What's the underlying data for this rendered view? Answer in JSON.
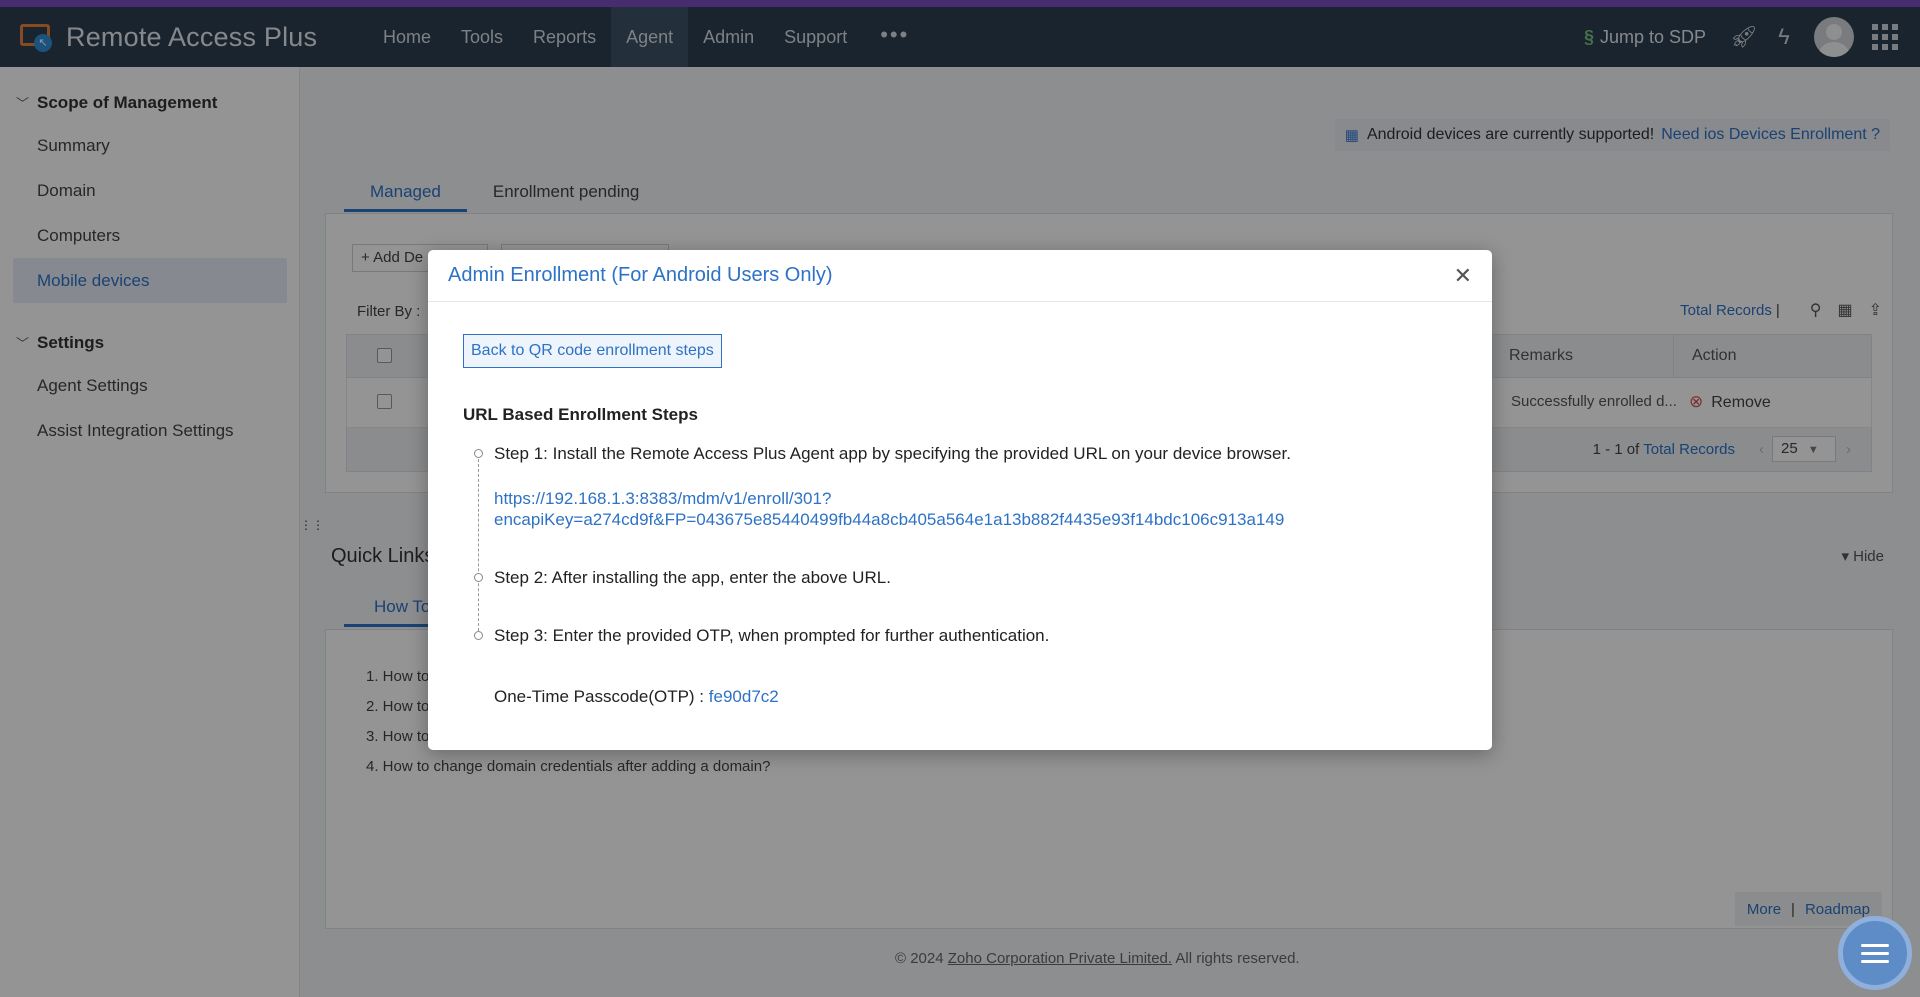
{
  "header": {
    "brand": "Remote Access Plus",
    "nav": [
      "Home",
      "Tools",
      "Reports",
      "Agent",
      "Admin",
      "Support"
    ],
    "nav_more": "•••",
    "jump_label": "Jump to SDP"
  },
  "sidebar": {
    "scope_title": "Scope of Management",
    "scope_items": [
      "Summary",
      "Domain",
      "Computers",
      "Mobile devices"
    ],
    "settings_title": "Settings",
    "settings_items": [
      "Agent Settings",
      "Assist Integration Settings"
    ]
  },
  "main": {
    "notice_text": "Android devices are currently supported!",
    "notice_link": "Need ios Devices Enrollment ?",
    "tabs": [
      "Managed",
      "Enrollment pending"
    ],
    "add_button": "Add De",
    "filter_label": "Filter By :",
    "total_records_link": "Total Records",
    "total_records_sep": "|",
    "table": {
      "col_remarks": "Remarks",
      "col_action": "Action",
      "row_remark": "Successfully enrolled d...",
      "row_action": "Remove"
    },
    "pager": {
      "range": "1 - 1 of",
      "total_link": "Total Records",
      "page_size": "25"
    },
    "quick_links_title": "Quick Links",
    "hide_label": "Hide",
    "howto_tab": "How To",
    "howto_items": [
      "1. How to",
      "2. How to",
      "3. How to",
      "4. How to change domain credentials after adding a domain?"
    ],
    "more_link": "More",
    "more_sep": "|",
    "roadmap_link": "Roadmap",
    "footer_prefix": "© 2024",
    "footer_company": "Zoho Corporation Private Limited.",
    "footer_suffix": "All rights reserved."
  },
  "modal": {
    "title": "Admin Enrollment (For Android Users Only)",
    "back_button": "Back to QR code enrollment steps",
    "steps_title": "URL Based Enrollment Steps",
    "step1": "Step 1: Install the Remote Access Plus Agent app by specifying the provided URL on your device browser.",
    "url_line1": "https://192.168.1.3:8383/mdm/v1/enroll/301?",
    "url_line2": "encapiKey=a274cd9f&FP=043675e85440499fb44a8cb405a564e1a13b882f4435e93f14bdc106c913a149",
    "step2": "Step 2: After installing the app, enter the above URL.",
    "step3": "Step 3: Enter the provided OTP, when prompted for further authentication.",
    "otp_label": "One-Time Passcode(OTP) :",
    "otp_value": "fe90d7c2"
  },
  "colors": {
    "accent": "#2d72c6",
    "topbar": "#2c3e50",
    "topbar_accent": "#7b4fc0"
  }
}
